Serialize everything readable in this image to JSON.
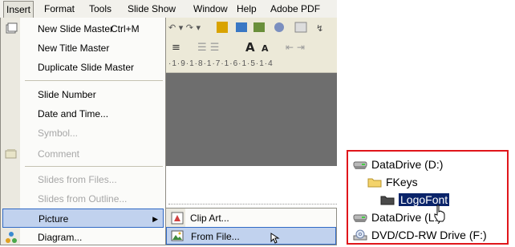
{
  "menubar": {
    "items": [
      "Insert",
      "Format",
      "Tools",
      "Slide Show",
      "Window",
      "Help",
      "Adobe PDF"
    ]
  },
  "ruler": {
    "text": "·1·9·1·8·1·7·1·6·1·5·1·4"
  },
  "insert_menu": {
    "items": [
      {
        "label": "New Slide Master",
        "shortcut": "Ctrl+M",
        "enabled": true,
        "icon": "slide-master-icon"
      },
      {
        "label": "New Title Master",
        "enabled": true
      },
      {
        "label": "Duplicate Slide Master",
        "enabled": true
      },
      {
        "label": "Slide Number",
        "enabled": true
      },
      {
        "label": "Date and Time...",
        "enabled": true
      },
      {
        "label": "Symbol...",
        "enabled": false
      },
      {
        "label": "Comment",
        "enabled": false,
        "icon": "comment-icon"
      },
      {
        "label": "Slides from Files...",
        "enabled": false
      },
      {
        "label": "Slides from Outline...",
        "enabled": false
      },
      {
        "label": "Picture",
        "enabled": true,
        "has_submenu": true
      },
      {
        "label": "Diagram...",
        "enabled": true,
        "icon": "diagram-icon"
      }
    ]
  },
  "picture_submenu": {
    "items": [
      {
        "label": "Clip Art...",
        "icon": "clip-art-icon"
      },
      {
        "label": "From File...",
        "icon": "from-file-icon"
      }
    ]
  },
  "explorer": {
    "items": [
      {
        "label": "DataDrive (D:)",
        "icon": "network-drive-icon"
      },
      {
        "label": "FKeys",
        "icon": "folder-icon"
      },
      {
        "label": "LogoFont",
        "icon": "folder-open-icon",
        "selected": true
      },
      {
        "label": "DataDrive (L:)",
        "icon": "network-drive-icon"
      },
      {
        "label": "DVD/CD-RW Drive (F:)",
        "icon": "dvd-drive-icon"
      }
    ]
  },
  "colors": {
    "menu_highlight": "#c1d2ee",
    "menu_highlight_border": "#316ac5",
    "selection": "#0a246a",
    "panel_border": "#e0161b"
  }
}
